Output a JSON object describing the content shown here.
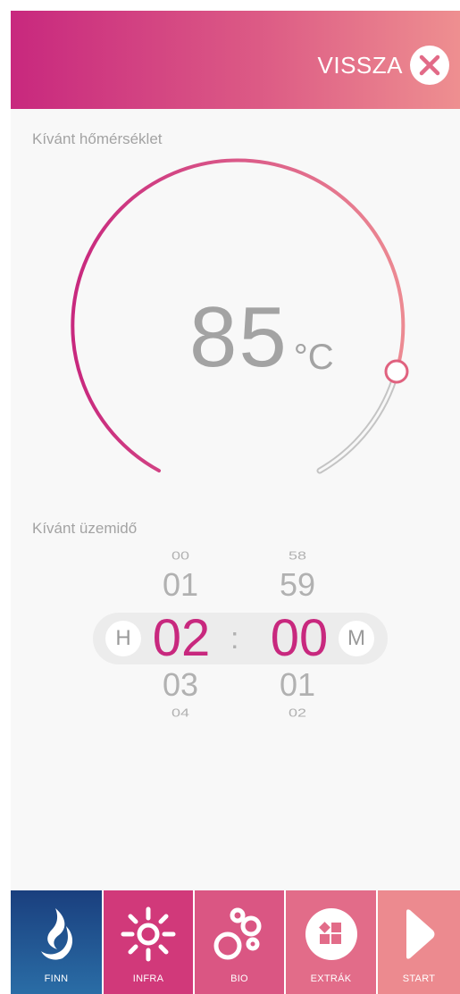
{
  "header": {
    "back_label": "VISSZA"
  },
  "temperature": {
    "label": "Kívánt hőmérséklet",
    "value": "85",
    "unit": "°C",
    "level": 0.78
  },
  "runtime": {
    "label": "Kívánt üzemidő",
    "hours": {
      "far_above": "00",
      "above": "01",
      "selected": "02",
      "below": "03",
      "far_below": "04",
      "unit": "H"
    },
    "minutes": {
      "far_above": "58",
      "above": "59",
      "selected": "00",
      "below": "01",
      "far_below": "02",
      "unit": "M"
    },
    "separator": ":"
  },
  "nav": [
    {
      "label": "FINN",
      "icon": "flame-icon",
      "active": true
    },
    {
      "label": "INFRA",
      "icon": "sun-icon",
      "active": false
    },
    {
      "label": "BIO",
      "icon": "bubbles-icon",
      "active": false
    },
    {
      "label": "EXTRÁK",
      "icon": "extras-icon",
      "active": false
    },
    {
      "label": "START",
      "icon": "play-icon",
      "active": false
    }
  ],
  "colors": {
    "accent": "#c8287e",
    "accent_light": "#ee8f90",
    "active_nav": "#1b4f8e"
  }
}
